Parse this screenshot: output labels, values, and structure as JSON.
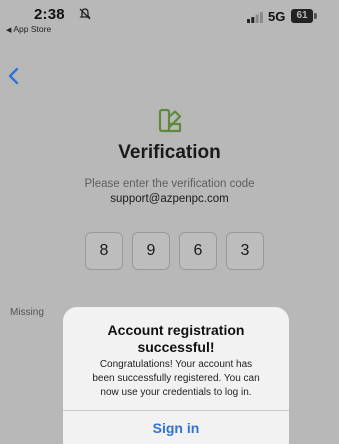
{
  "status_bar": {
    "time": "2:38",
    "back_to_app": "App Store",
    "network": "5G",
    "battery": "61"
  },
  "nav": {
    "back_icon": "chevron-left-icon"
  },
  "main": {
    "logo_icon": "swatch-book-icon",
    "title": "Verification",
    "instruction": "Please enter the verification code",
    "email": "support@azpenpc.com",
    "code_digits": [
      "8",
      "9",
      "6",
      "3"
    ],
    "missing_text": "Missing"
  },
  "modal": {
    "title_line1": "Account registration",
    "title_line2": "successful!",
    "message_line1": "Congratulations! Your account has",
    "message_line2": "been successfully registered. You can",
    "message_line3": "now use your credentials to log in.",
    "button_label": "Sign in"
  },
  "colors": {
    "background": "#b8b8b8",
    "accent_blue": "#2f74d0",
    "logo_green": "#5f8a3a",
    "modal_bg": "#f2f2f2"
  }
}
